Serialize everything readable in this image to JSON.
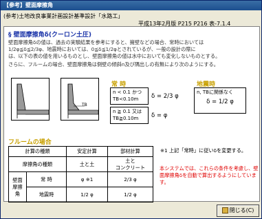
{
  "window": {
    "title": "【参考】壁面摩擦角"
  },
  "header": {
    "source": "(参考)土地改良事業計画設計基準設計「水路工」",
    "edition": "平成13年2月版 P215 P216 表-7.1.4"
  },
  "section": {
    "title": "§ 壁面摩擦角δ(クーロン土圧)",
    "para1_line1": "壁面摩擦角δの値は、過去の実験結果を参考にすると、擁壁などの場合、常時においては",
    "para1_line2": "1/2φ≦δ≦2/3φ、地震時においては、0≦δ≦1/2φとされているが、一般の設計の際に",
    "para1_line3": "は、以下の表の値を用いるものとし、壁面摩擦角の値は水中においても変化しないものとする。",
    "para2": "さらに、フルームの場合、壁面摩擦角は側壁の傾斜n及び隅出しの有無により次のようにする。"
  },
  "figure2_label": "TB",
  "normal": {
    "heading": "常 時",
    "cond1_a": "n < 0.1 かつ",
    "cond1_b": "TB<0.10m",
    "formula1": "δ = 2/3 φ",
    "cond2_a": "n ≧ 0.1 又は",
    "cond2_b": "TB≧0.10m",
    "formula2": "δ = φ"
  },
  "seismic": {
    "heading": "地震時",
    "cond": "n, TBに関係なく",
    "formula": "δ = 1/2 φ"
  },
  "flume": {
    "title": "フルームの場合",
    "h_calc": "計算の種類",
    "h_stab": "安定計算",
    "h_memb": "部材計算",
    "row_type": "摩擦角の種類",
    "stab_type": "土と土",
    "memb_type_1": "土と",
    "memb_type_2": "コンクリート",
    "group_label_1": "壁面",
    "group_label_2": "摩擦角",
    "normal_label": "常 時",
    "normal_stab": "φ ※1",
    "normal_memb": "2/3 φ",
    "seismic_label": "地震時",
    "seismic_stab": "1/2 φ",
    "seismic_memb": "1/2 φ"
  },
  "note": "※1 上記「常時」に従いδを変更する。",
  "red_note": "本システムでは、これらの条件を考慮し、壁面摩擦角δを自動で算出するようにしています。",
  "close_button": {
    "label": "閉じる(C)"
  }
}
